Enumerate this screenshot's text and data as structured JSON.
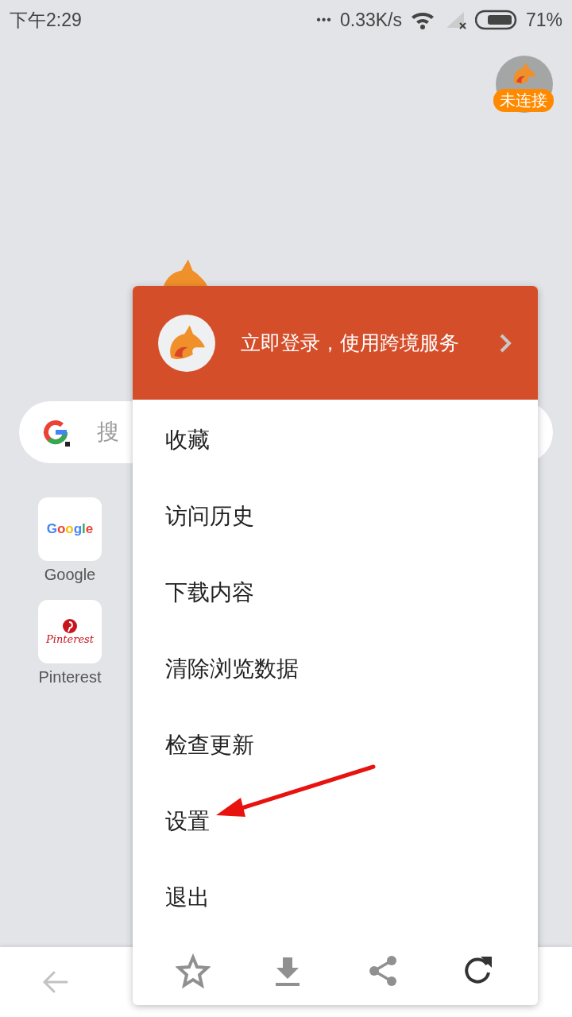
{
  "status_bar": {
    "time": "下午2:29",
    "more": "•••",
    "speed": "0.33K/s",
    "battery": "71%"
  },
  "account": {
    "badge": "未连接"
  },
  "search": {
    "placeholder": "搜"
  },
  "shortcuts": [
    {
      "kind": "google",
      "logo": "Google",
      "label": "Google"
    },
    {
      "kind": "pinterest",
      "logo": "Pinterest",
      "label": "Pinterest"
    }
  ],
  "menu": {
    "header": "立即登录，使用跨境服务",
    "items": [
      "收藏",
      "访问历史",
      "下载内容",
      "清除浏览数据",
      "检查更新",
      "设置",
      "退出"
    ]
  }
}
